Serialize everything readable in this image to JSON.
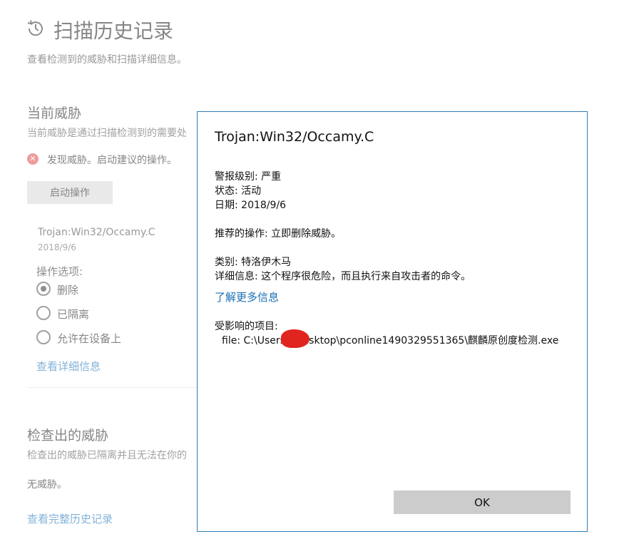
{
  "page": {
    "title": "扫描历史记录",
    "subtitle": "查看检测到的威胁和扫描详细信息。"
  },
  "current_threats": {
    "title": "当前威胁",
    "subtitle": "当前威胁是通过扫描检测到的需要处",
    "warning": "发现威胁。启动建议的操作。",
    "start_button": "启动操作",
    "threat_name": "Trojan:Win32/Occamy.C",
    "threat_date": "2018/9/6",
    "options_title": "操作选项:",
    "options": [
      {
        "label": "删除",
        "selected": true
      },
      {
        "label": "已隔离",
        "selected": false
      },
      {
        "label": "允许在设备上",
        "selected": false
      }
    ],
    "details_link": "查看详细信息"
  },
  "detected_threats": {
    "title": "检查出的威胁",
    "subtitle": "检查出的威胁已隔离并且无法在你的",
    "none": "无威胁。",
    "history_link": "查看完整历史记录"
  },
  "dialog": {
    "title": "Trojan:Win32/Occamy.C",
    "alert_level": "警报级别: 严重",
    "status": "状态: 活动",
    "date": "日期:  2018/9/6",
    "recommended": "推荐的操作: 立即删除威胁。",
    "category": "类别: 特洛伊木马",
    "details": "详细信息: 这个程序很危险，而且执行来自攻击者的命令。",
    "learn_more": "了解更多信息",
    "affected_label": "受影响的项目:",
    "file_path": "file: C:\\Users\\        \\Desktop\\pconline1490329551365\\麒麟原创度检测.exe",
    "ok_button": "OK"
  },
  "colors": {
    "dialog_border": "#2b7fb4",
    "link": "#1a73b9",
    "error": "#e04c4c",
    "redaction": "#e0251e"
  }
}
